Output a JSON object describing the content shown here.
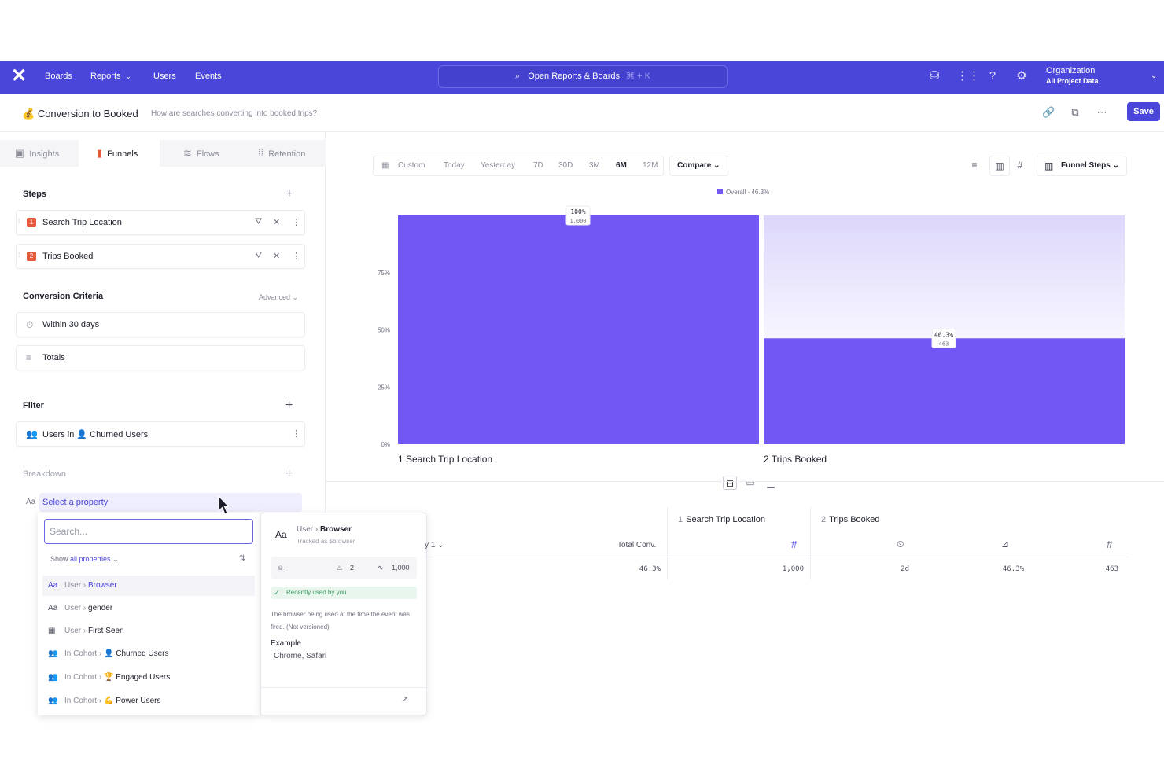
{
  "nav": {
    "items": [
      "Boards",
      "Reports",
      "Users",
      "Events"
    ],
    "search_label": "Open Reports & Boards",
    "search_shortcut": "⌘ + K",
    "org_title": "Organization",
    "org_subtitle": "All Project Data"
  },
  "report": {
    "emoji": "💰",
    "title": "Conversion to Booked",
    "description": "How are searches converting into booked trips?",
    "save_label": "Save"
  },
  "tabs": [
    "Insights",
    "Funnels",
    "Flows",
    "Retention"
  ],
  "steps": {
    "label": "Steps",
    "items": [
      {
        "num": "1",
        "name": "Search Trip Location"
      },
      {
        "num": "2",
        "name": "Trips Booked"
      }
    ]
  },
  "conversion": {
    "label": "Conversion Criteria",
    "advanced": "Advanced",
    "window": "Within 30 days",
    "counting": "Totals"
  },
  "filter": {
    "label": "Filter",
    "item_prefix": "Users in",
    "item_emoji": "👤",
    "item_name": "Churned Users"
  },
  "breakdown": {
    "label": "Breakdown",
    "aa": "Aa",
    "select_label": "Select a property"
  },
  "dropdown": {
    "search_placeholder": "Search...",
    "show_prefix": "Show",
    "show_value": "all properties",
    "items": [
      {
        "icon": "Aa",
        "path": "User ›",
        "leaf": "Browser"
      },
      {
        "icon": "Aa",
        "path": "User ›",
        "leaf": "gender"
      },
      {
        "icon": "▦",
        "path": "User ›",
        "leaf": "First Seen"
      },
      {
        "icon": "👥",
        "path": "In Cohort ›",
        "leaf": "👤 Churned Users"
      },
      {
        "icon": "👥",
        "path": "In Cohort ›",
        "leaf": "🏆 Engaged Users"
      },
      {
        "icon": "👥",
        "path": "In Cohort ›",
        "leaf": "💪 Power Users"
      }
    ]
  },
  "infocard": {
    "aa": "Aa",
    "path": "User ›",
    "name": "Browser",
    "tracked": "Tracked as $browser",
    "stat_emoji": "☺ -",
    "stat_hot": "2",
    "stat_count": "1,000",
    "recent": "Recently used by you",
    "description": "The browser being used at the time the event was fired. (Not versioned)",
    "example_label": "Example",
    "example_value": "Chrome, Safari"
  },
  "toolbar": {
    "date_ranges": [
      "Custom",
      "Today",
      "Yesterday",
      "7D",
      "30D",
      "3M",
      "6M",
      "12M"
    ],
    "active_range": "6M",
    "compare_label": "Compare",
    "funnel_steps_label": "Funnel Steps"
  },
  "chart_data": {
    "type": "bar",
    "legend": "Overall - 46.3%",
    "categories": [
      "1  Search Trip Location",
      "2  Trips Booked"
    ],
    "values": [
      100,
      46.3
    ],
    "counts": [
      "1,000",
      "463"
    ],
    "value_labels": [
      "100%",
      "46.3%"
    ],
    "yticks": [
      "0%",
      "25%",
      "50%",
      "75%"
    ],
    "ylim": [
      0,
      100
    ],
    "color": "#7357f5",
    "dropoff_color": "#e3e0fc"
  },
  "table": {
    "col_step1": "Search Trip Location",
    "col_step2": "Trips Booked",
    "step1_num": "1",
    "step2_num": "2",
    "group_label": "y 1",
    "total_conv_label": "Total Conv.",
    "total_conv_value": "46.3%",
    "step1_count": "1,000",
    "step2_time": "2d",
    "step2_rate": "46.3%",
    "step2_count": "463"
  }
}
